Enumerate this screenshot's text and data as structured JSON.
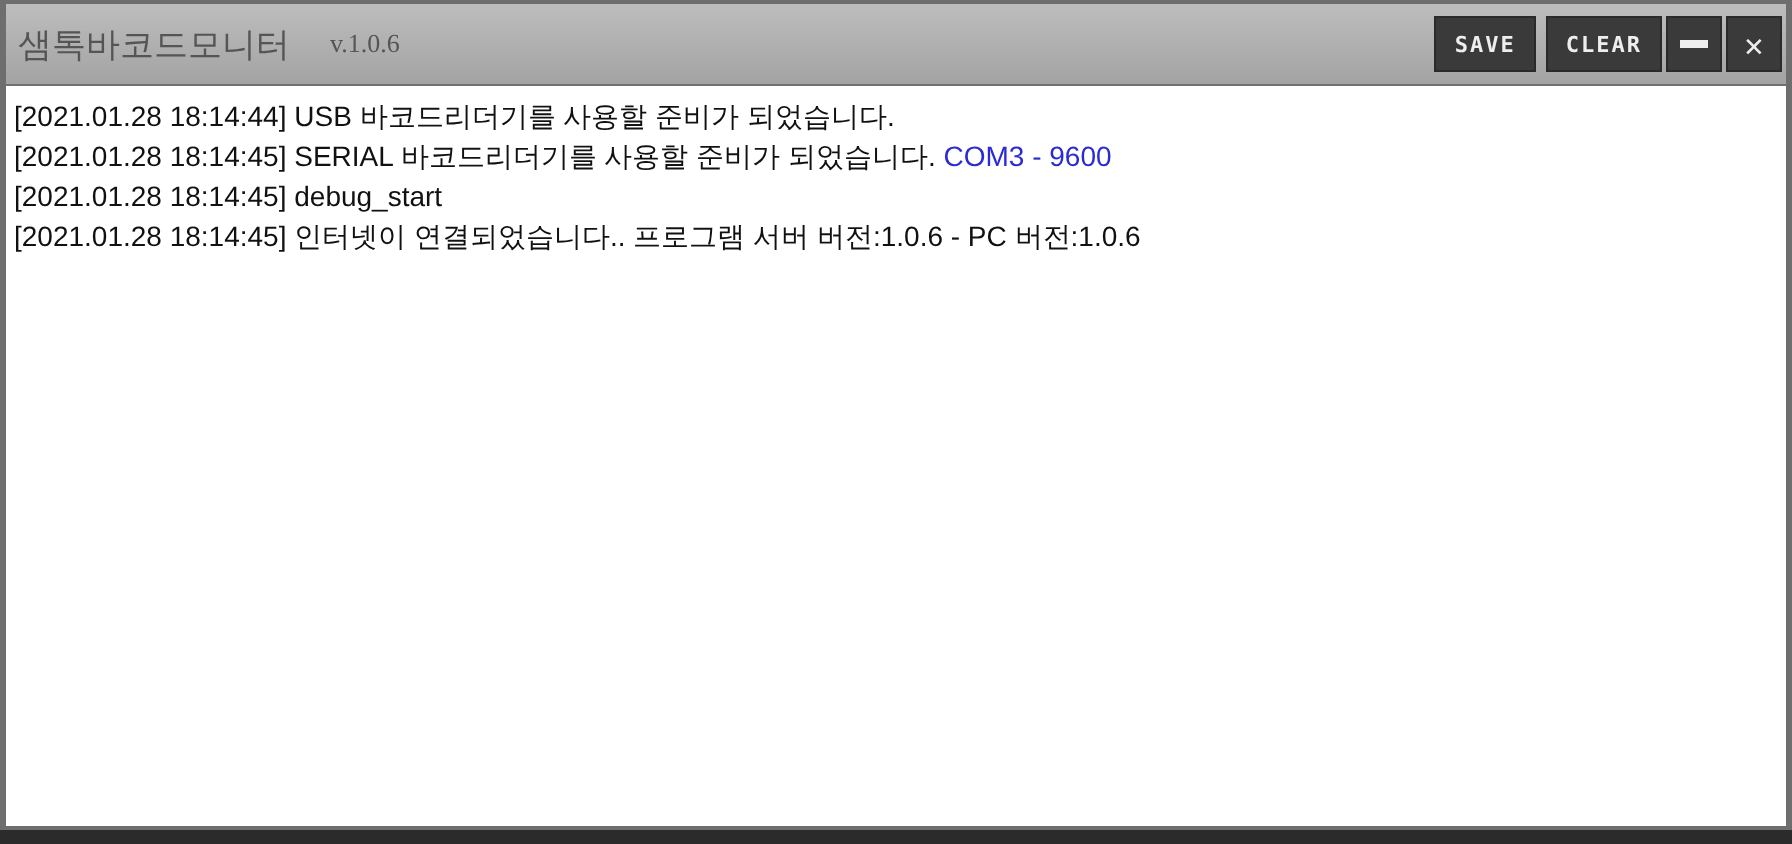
{
  "window": {
    "title": "샘톡바코드모니터",
    "version": "v.1.0.6"
  },
  "buttons": [
    {
      "kind": "text",
      "label": "SAVE"
    },
    {
      "kind": "text",
      "label": "CLEAR"
    },
    {
      "kind": "minimize"
    },
    {
      "kind": "close",
      "label": "✕"
    }
  ],
  "log": [
    {
      "time": "[2021.01.28 18:14:44]",
      "message": "USB 바코드리더기를 사용할 준비가 되었습니다."
    },
    {
      "time": "[2021.01.28 18:14:45]",
      "message": "SERIAL 바코드리더기를 사용할 준비가 되었습니다.",
      "highlight": "COM3 - 9600"
    },
    {
      "time": "[2021.01.28 18:14:45]",
      "message": "debug_start"
    },
    {
      "time": "[2021.01.28 18:14:45]",
      "message": "인터넷이 연결되었습니다.. 프로그램 서버 버전:1.0.6 - PC 버전:1.0.6"
    }
  ]
}
